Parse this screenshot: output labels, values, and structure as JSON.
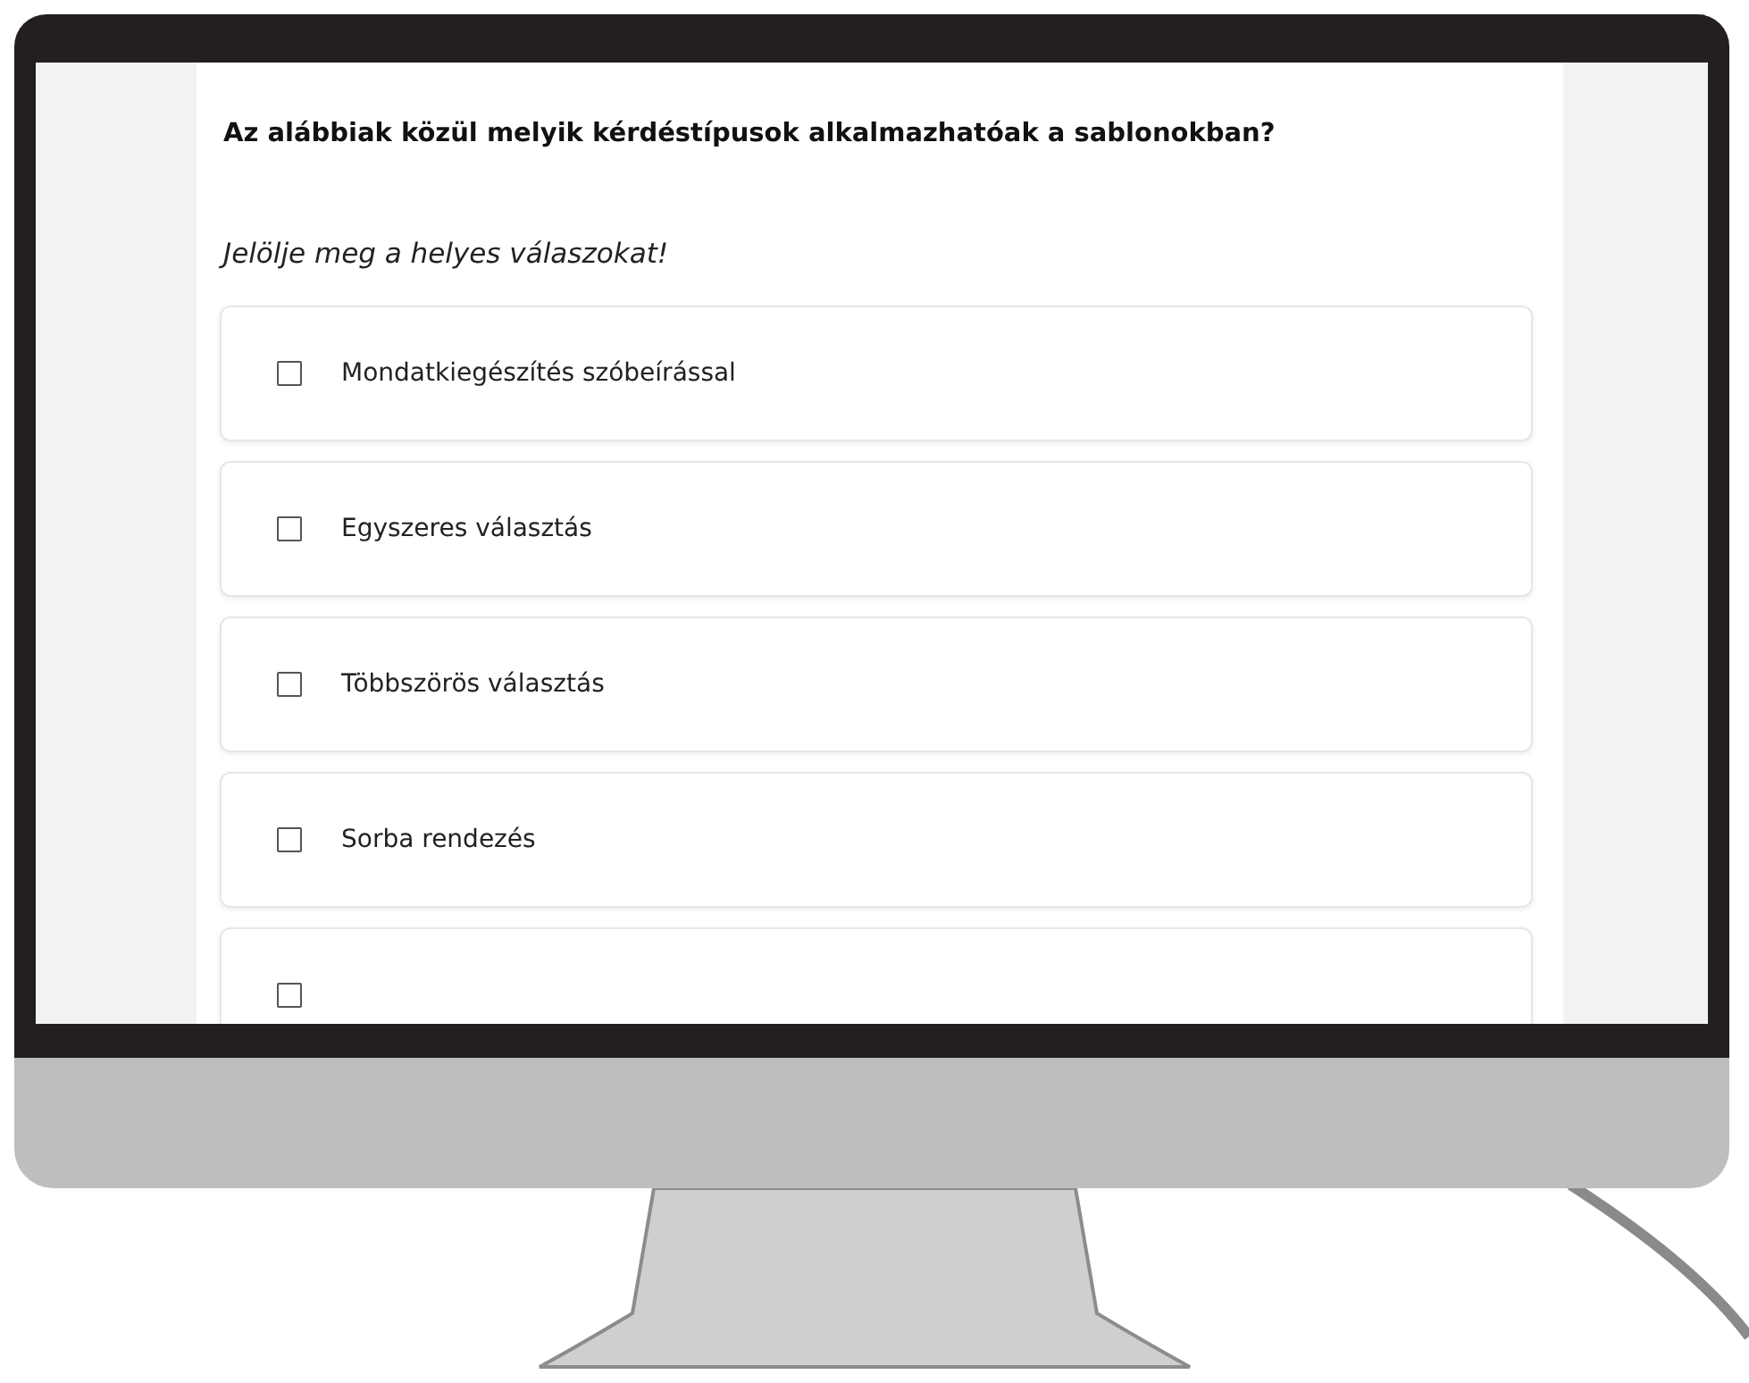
{
  "question": "Az alábbiak közül melyik kérdéstípusok alkalmazhatóak a sablonokban?",
  "instruction": "Jelölje meg a helyes válaszokat!",
  "options": [
    {
      "label": "Mondatkiegészítés szóbeírással",
      "checked": false
    },
    {
      "label": "Egyszeres választás",
      "checked": false
    },
    {
      "label": "Többszörös választás",
      "checked": false
    },
    {
      "label": "Sorba rendezés",
      "checked": false
    }
  ],
  "cut_off_option": {
    "checked": false
  }
}
